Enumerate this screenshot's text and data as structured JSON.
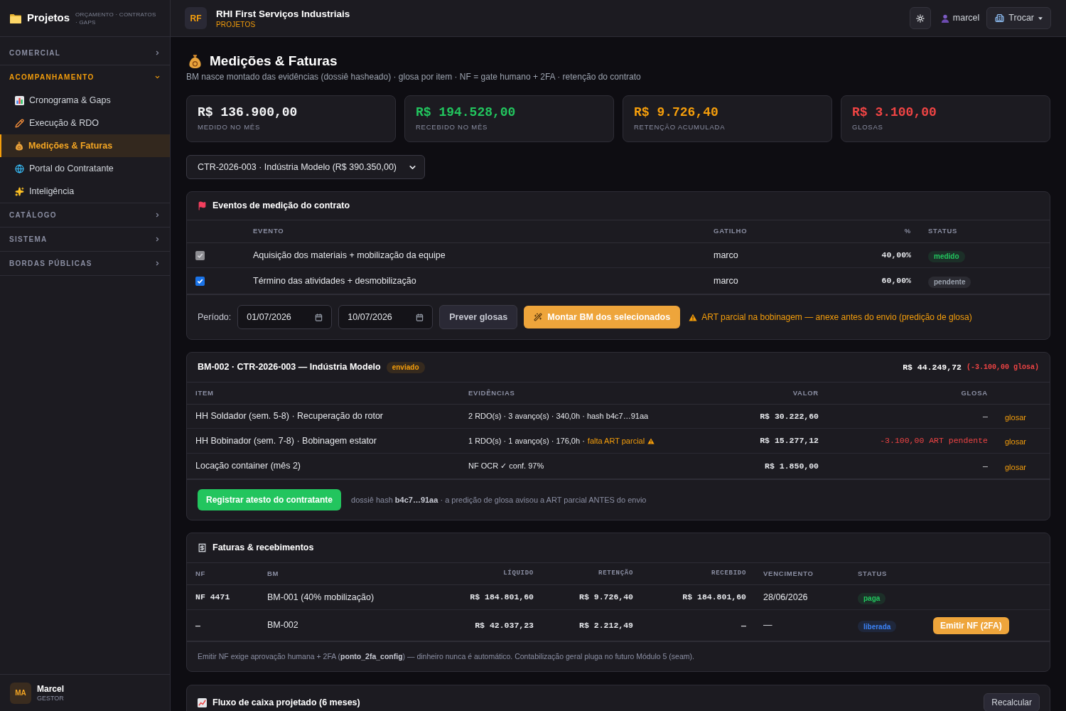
{
  "sidebar": {
    "brand": {
      "title": "Projetos",
      "tagline": "ORÇAMENTO · CONTRATOS · GAPS"
    },
    "sections": [
      {
        "label": "COMERCIAL",
        "expanded": false
      },
      {
        "label": "ACOMPANHAMENTO",
        "expanded": true,
        "items": [
          {
            "label": "Cronograma & Gaps",
            "selected": false
          },
          {
            "label": "Execução & RDO",
            "selected": false
          },
          {
            "label": "Medições & Faturas",
            "selected": true
          },
          {
            "label": "Portal do Contratante",
            "selected": false
          },
          {
            "label": "Inteligência",
            "selected": false
          }
        ]
      },
      {
        "label": "CATÁLOGO",
        "expanded": false
      },
      {
        "label": "SISTEMA",
        "expanded": false
      },
      {
        "label": "BORDAS PÚBLICAS",
        "expanded": false
      }
    ],
    "user": {
      "initials": "MA",
      "name": "Marcel",
      "role": "GESTOR"
    }
  },
  "header": {
    "logo": "RF",
    "company": "RHI First Serviços Industriais",
    "module": "PROJETOS",
    "user": "marcel",
    "switch_button": "Trocar"
  },
  "page": {
    "title": "Medições & Faturas",
    "subtitle": "BM nasce montado das evidências (dossiê hasheado) · glosa por item · NF = gate humano + 2FA · retenção do contrato"
  },
  "kpis": [
    {
      "value": "R$ 136.900,00",
      "label": "MEDIDO NO MÊS",
      "color": "#f3f4f6"
    },
    {
      "value": "R$ 194.528,00",
      "label": "RECEBIDO NO MÊS",
      "color": "#22c55e"
    },
    {
      "value": "R$ 9.726,40",
      "label": "RETENÇÃO ACUMULADA",
      "color": "#f59e0b"
    },
    {
      "value": "R$ 3.100,00",
      "label": "GLOSAS",
      "color": "#ef4444"
    }
  ],
  "contract_select": {
    "value": "CTR-2026-003 · Indústria Modelo (R$ 390.350,00)"
  },
  "events": {
    "title": "Eventos de medição do contrato",
    "columns": [
      "EVENTO",
      "GATILHO",
      "%",
      "STATUS"
    ],
    "rows": [
      {
        "checked": true,
        "disabled": true,
        "event": "Aquisição dos materiais + mobilização da equipe",
        "trigger": "marco",
        "percent": "40,00%",
        "status": {
          "label": "medido",
          "color": "#22c55e"
        }
      },
      {
        "checked": true,
        "disabled": false,
        "event": "Término das atividades + desmobilização",
        "trigger": "marco",
        "percent": "60,00%",
        "status": {
          "label": "pendente",
          "color": "#9ca3af"
        }
      }
    ],
    "period": {
      "label": "Período:",
      "start": "01/07/2026",
      "end": "10/07/2026"
    },
    "preview_button": "Prever glosas",
    "build_button": "Montar BM dos selecionados",
    "warning": "ART parcial na bobinagem — anexe antes do envio (predição de glosa)"
  },
  "bm": {
    "title": "BM-002 · CTR-2026-003 — Indústria Modelo",
    "status": {
      "label": "enviado",
      "color": "#f59e0b"
    },
    "total": "R$ 44.249,72",
    "total_glosa": "(-3.100,00 glosa)",
    "columns": [
      "ITEM",
      "EVIDÊNCIAS",
      "VALOR",
      "GLOSA"
    ],
    "rows": [
      {
        "item": "HH Soldador (sem. 5-8) · Recuperação do rotor",
        "evidence": "2 RDO(s) · 3 avanço(s) · 340,0h · hash b4c7…91aa",
        "value": "R$ 30.222,60",
        "glosa": "—",
        "glosa_flagged": false,
        "action": "glosar"
      },
      {
        "item": "HH Bobinador (sem. 7-8) · Bobinagem estator",
        "evidence": "1 RDO(s) · 1 avanço(s) · 176,0h ·",
        "warning": "falta ART parcial",
        "value": "R$ 15.277,12",
        "glosa": "-3.100,00 ART pendente",
        "glosa_flagged": true,
        "action": "glosar"
      },
      {
        "item": "Locação container (mês 2)",
        "evidence": "NF OCR ✓ conf. 97%",
        "value": "R$ 1.850,00",
        "glosa": "—",
        "glosa_flagged": false,
        "action": "glosar"
      }
    ],
    "register_button": "Registrar atesto do contratante",
    "note": "dossiê hash **b4c7…91aa** · a predição de glosa avisou a ART parcial ANTES do envio"
  },
  "invoices": {
    "title": "Faturas & recebimentos",
    "columns": [
      "NF",
      "BM",
      "LÍQUIDO",
      "RETENÇÃO",
      "RECEBIDO",
      "VENCIMENTO",
      "STATUS"
    ],
    "rows": [
      {
        "nf": "NF 4471",
        "bm": "BM-001 (40% mobilização)",
        "net": "R$ 184.801,60",
        "retention": "R$ 9.726,40",
        "received": "R$ 184.801,60",
        "due": "28/06/2026",
        "status": {
          "label": "paga",
          "color": "#22c55e"
        }
      },
      {
        "nf": "—",
        "bm": "BM-002",
        "net": "R$ 42.037,23",
        "retention": "R$ 2.212,49",
        "received": "—",
        "due": "—",
        "status": {
          "label": "liberada",
          "color": "#3b82f6"
        },
        "action": "Emitir NF (2FA)"
      }
    ],
    "note": "Emitir NF exige aprovação humana + 2FA (**ponto_2fa_config**) — dinheiro nunca é automático. Contabilização geral pluga no futuro Módulo 5 (seam)."
  },
  "cashflow": {
    "title": "Fluxo de caixa projetado (6 meses)",
    "button": "Recalcular"
  }
}
